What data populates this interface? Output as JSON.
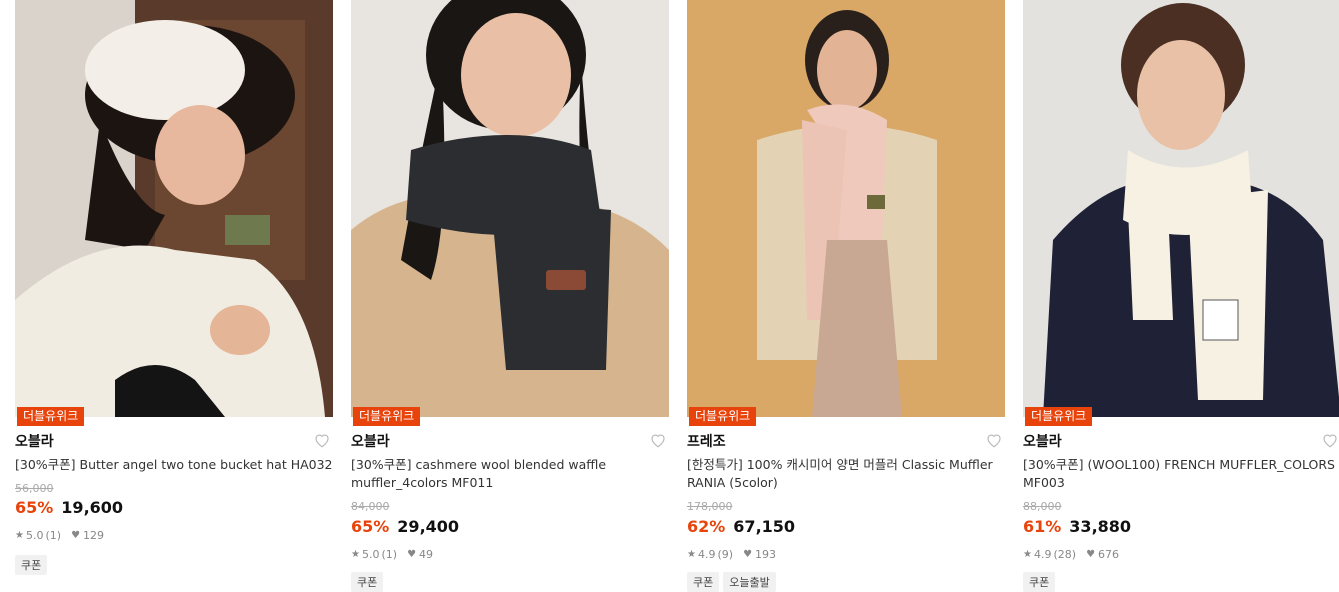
{
  "products": [
    {
      "badge": "더블유위크",
      "brand": "오블라",
      "name": "[30%쿠폰] Butter angel two tone bucket hat HA032",
      "original_price": "56,000",
      "discount": "65%",
      "price": "19,600",
      "rating": "5.0",
      "reviews": "(1)",
      "likes": "129",
      "tags": [
        "쿠폰"
      ]
    },
    {
      "badge": "더블유위크",
      "brand": "오블라",
      "name": "[30%쿠폰] cashmere wool blended waffle muffler_4colors MF011",
      "original_price": "84,000",
      "discount": "65%",
      "price": "29,400",
      "rating": "5.0",
      "reviews": "(1)",
      "likes": "49",
      "tags": [
        "쿠폰"
      ]
    },
    {
      "badge": "더블유위크",
      "brand": "프레조",
      "name": "[한정특가] 100% 캐시미어 양면 머플러 Classic Muffler RANIA (5color)",
      "original_price": "178,000",
      "discount": "62%",
      "price": "67,150",
      "rating": "4.9",
      "reviews": "(9)",
      "likes": "193",
      "tags": [
        "쿠폰",
        "오늘출발"
      ]
    },
    {
      "badge": "더블유위크",
      "brand": "오블라",
      "name": "[30%쿠폰] (WOOL100) FRENCH MUFFLER_COLORS MF003",
      "original_price": "88,000",
      "discount": "61%",
      "price": "33,880",
      "rating": "4.9",
      "reviews": "(28)",
      "likes": "676",
      "tags": [
        "쿠폰"
      ]
    }
  ],
  "icons": {
    "wishlist": "heart-outline-icon",
    "rating": "star-icon",
    "likes": "heart-icon"
  },
  "colors": {
    "accent": "#e8430b"
  }
}
